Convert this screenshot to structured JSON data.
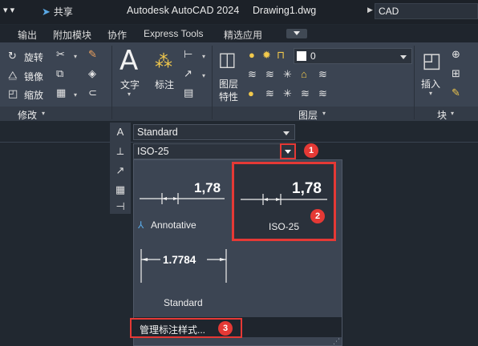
{
  "title_bar": {
    "quick_access": "▾  ▾",
    "share_label": "共享",
    "app_title": "Autodesk AutoCAD 2024",
    "document_title": "Drawing1.dwg",
    "search_value": "CAD"
  },
  "menu_tabs": [
    "输出",
    "附加模块",
    "协作",
    "Express Tools",
    "精选应用"
  ],
  "ribbon": {
    "modify": {
      "rotate": "旋转",
      "mirror": "镜像",
      "scale": "缩放",
      "title": "修改"
    },
    "annotation": {
      "text": "文字",
      "dimension": "标注"
    },
    "layers": {
      "properties_line1": "图层",
      "properties_line2": "特性",
      "current_layer": "0",
      "title": "图层"
    },
    "block": {
      "insert": "插入",
      "title": "块"
    }
  },
  "annotation_toolbar": {
    "text_style": "Standard",
    "dim_style": "ISO-25"
  },
  "dim_style_gallery": {
    "styles": [
      {
        "name": "Annotative",
        "sample": "1,78"
      },
      {
        "name": "ISO-25",
        "sample": "1,78"
      },
      {
        "name": "Standard",
        "sample": "1.7784"
      }
    ],
    "manage_label": "管理标注样式..."
  },
  "callouts": [
    "1",
    "2",
    "3"
  ],
  "colors": {
    "highlight": "#e53935",
    "ribbon_bg": "#3b4452",
    "gallery_bg": "#3c4553"
  }
}
